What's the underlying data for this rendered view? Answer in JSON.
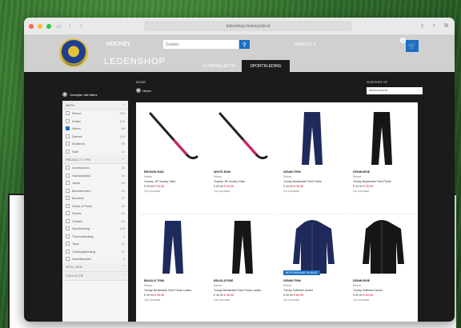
{
  "browser": {
    "address": "ledenshop.hockeyclub.nl",
    "controls": {
      "back": "‹",
      "forward": "›",
      "sidebar": "▭"
    }
  },
  "header": {
    "brand": "HOCKEY",
    "shop_title": "LEDENSHOP",
    "search_placeholder": "Zoeken",
    "menu_label": "SERVICE ∨",
    "cart_count": "1",
    "tabs": [
      {
        "label": "CLUBCOLLECTIE",
        "active": false
      },
      {
        "label": "SPORTKLEDING",
        "active": true
      }
    ]
  },
  "content": {
    "clear_filters": "Verwijder alle filters",
    "crumb_title": "MODE",
    "crumb_chip": "Heren",
    "sort_label": "SORTEER OP",
    "sort_value": "Meest recent",
    "sidebar": {
      "sections": [
        {
          "title": "MERK",
          "items": [
            {
              "label": "Reece",
              "count": "204",
              "checked": false
            },
            {
              "label": "Indian",
              "count": "115",
              "checked": false
            },
            {
              "label": "Heren",
              "count": "98",
              "checked": true
            },
            {
              "label": "Dames",
              "count": "118",
              "checked": false
            },
            {
              "label": "Kinderen",
              "count": "95",
              "checked": false
            },
            {
              "label": "Sale",
              "count": "12",
              "checked": false
            }
          ]
        },
        {
          "title": "PRODUCT TYPE",
          "items": [
            {
              "label": "Accessoires",
              "count": "28",
              "checked": false
            },
            {
              "label": "Hockeysticks",
              "count": "34",
              "checked": false
            },
            {
              "label": "Jacks",
              "count": "18",
              "checked": false
            },
            {
              "label": "Beschermers",
              "count": "14",
              "checked": false
            },
            {
              "label": "Broeken",
              "count": "21",
              "checked": false
            },
            {
              "label": "Shirts & Polos",
              "count": "42",
              "checked": false
            },
            {
              "label": "Shorts",
              "count": "25",
              "checked": false
            },
            {
              "label": "Sokken",
              "count": "16",
              "checked": false
            },
            {
              "label": "Sportkleding",
              "count": "115",
              "checked": false
            },
            {
              "label": "Thermokleding",
              "count": "9",
              "checked": false
            },
            {
              "label": "Tops",
              "count": "12",
              "checked": false
            },
            {
              "label": "Trainingskleding",
              "count": "37",
              "checked": false
            },
            {
              "label": "Zweetbanden",
              "count": "6",
              "checked": false
            }
          ]
        },
        {
          "title": "STIJL ZIEN",
          "items": []
        },
        {
          "title": "COLLECTIE",
          "items": []
        }
      ]
    },
    "products": [
      {
        "kind": "stick",
        "name": "BRONZE-RAM",
        "brand": "Indian",
        "desc": "Hockey JR Hockey Stick",
        "price": "€ 49,95",
        "sale": "€ 34,95",
        "stock": "Op voorraad",
        "badge": ""
      },
      {
        "kind": "stick",
        "name": "WHITE-RAM",
        "brand": "Indian",
        "desc": "Hockey JR Hockey Stick",
        "price": "€ 59,95",
        "sale": "€ 44,95",
        "stock": "Op voorraad",
        "badge": ""
      },
      {
        "kind": "pants-navy",
        "name": "DENIM-TRIM",
        "brand": "Reece",
        "desc": "Tunlay Breathable Pant Pants",
        "price": "€ 49,95",
        "sale": "€ 39,95",
        "stock": "Op voorraad",
        "badge": ""
      },
      {
        "kind": "pants-black",
        "name": "DENIM-RISE",
        "brand": "Reece",
        "desc": "Tunlay Breathable Pant Pants",
        "price": "€ 49,95",
        "sale": "€ 39,95",
        "stock": "Op voorraad",
        "badge": ""
      },
      {
        "kind": "pants-navy",
        "name": "BEAGLE-TRIM",
        "brand": "Reece",
        "desc": "Tunlay Breathable Pant Pants Ladies",
        "price": "€ 49,95",
        "sale": "€ 39,95",
        "stock": "Op voorraad",
        "badge": ""
      },
      {
        "kind": "pants-black",
        "name": "BEAGLE-RISE",
        "brand": "Reece",
        "desc": "Tunlay Breathable Pant Pants Ladies",
        "price": "€ 49,95",
        "sale": "€ 39,95",
        "stock": "Op voorraad",
        "badge": ""
      },
      {
        "kind": "jacket-navy",
        "name": "DENIM-TRIM",
        "brand": "Reece",
        "desc": "Tunlay Softshell Jacket",
        "price": "€ 89,95",
        "sale": "€ 69,95",
        "stock": "Op voorraad",
        "badge": "BESCHIKBAAR IN MAAT"
      },
      {
        "kind": "jacket-black",
        "name": "DENIM-RISE",
        "brand": "Reece",
        "desc": "Tunlay Softshell Jacket",
        "price": "€ 89,95",
        "sale": "€ 69,95",
        "stock": "Op voorraad",
        "badge": ""
      }
    ]
  },
  "colors": {
    "accent": "#1a6fc4",
    "header_bg": "#d0d0d0",
    "content_bg": "#1b1b1b",
    "sale": "#d0021b"
  }
}
